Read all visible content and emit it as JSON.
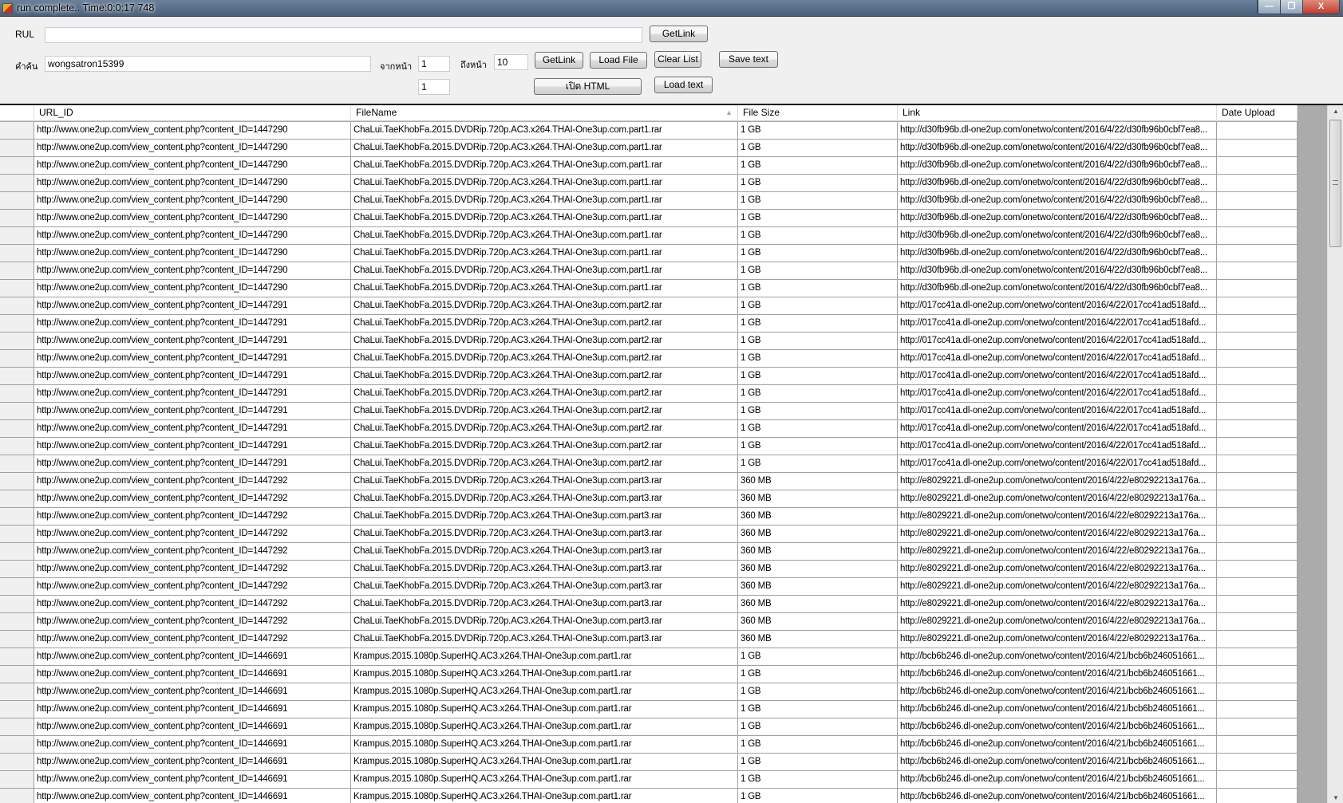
{
  "window": {
    "title": "run complete.. Time:0:0:17 748"
  },
  "form": {
    "url_label": "RUL",
    "url_value": "",
    "getlink_top": "GetLink",
    "search_label": "คำค้น",
    "search_value": "wongsatron15399",
    "from_page_label": "จากหน้า",
    "from_page_value": "1",
    "to_page_label": "ถึงหน้า",
    "to_page_value": "10",
    "getlink2": "GetLink",
    "load_file": "Load File",
    "clear_list": "Clear List",
    "save_text": "Save text",
    "extra_value": "1",
    "open_html": "เปิด HTML",
    "load_text": "Load text"
  },
  "table": {
    "columns": [
      "URL_ID",
      "FileName",
      "File Size",
      "Link",
      "Date Upload"
    ],
    "rows": [
      [
        "http://www.one2up.com/view_content.php?content_ID=1447290",
        "ChaLui.TaeKhobFa.2015.DVDRip.720p.AC3.x264.THAI-One3up.com.part1.rar",
        "1 GB",
        "http://d30fb96b.dl-one2up.com/onetwo/content/2016/4/22/d30fb96b0cbf7ea8...",
        ""
      ],
      [
        "http://www.one2up.com/view_content.php?content_ID=1447290",
        "ChaLui.TaeKhobFa.2015.DVDRip.720p.AC3.x264.THAI-One3up.com.part1.rar",
        "1 GB",
        "http://d30fb96b.dl-one2up.com/onetwo/content/2016/4/22/d30fb96b0cbf7ea8...",
        ""
      ],
      [
        "http://www.one2up.com/view_content.php?content_ID=1447290",
        "ChaLui.TaeKhobFa.2015.DVDRip.720p.AC3.x264.THAI-One3up.com.part1.rar",
        "1 GB",
        "http://d30fb96b.dl-one2up.com/onetwo/content/2016/4/22/d30fb96b0cbf7ea8...",
        ""
      ],
      [
        "http://www.one2up.com/view_content.php?content_ID=1447290",
        "ChaLui.TaeKhobFa.2015.DVDRip.720p.AC3.x264.THAI-One3up.com.part1.rar",
        "1 GB",
        "http://d30fb96b.dl-one2up.com/onetwo/content/2016/4/22/d30fb96b0cbf7ea8...",
        ""
      ],
      [
        "http://www.one2up.com/view_content.php?content_ID=1447290",
        "ChaLui.TaeKhobFa.2015.DVDRip.720p.AC3.x264.THAI-One3up.com.part1.rar",
        "1 GB",
        "http://d30fb96b.dl-one2up.com/onetwo/content/2016/4/22/d30fb96b0cbf7ea8...",
        ""
      ],
      [
        "http://www.one2up.com/view_content.php?content_ID=1447290",
        "ChaLui.TaeKhobFa.2015.DVDRip.720p.AC3.x264.THAI-One3up.com.part1.rar",
        "1 GB",
        "http://d30fb96b.dl-one2up.com/onetwo/content/2016/4/22/d30fb96b0cbf7ea8...",
        ""
      ],
      [
        "http://www.one2up.com/view_content.php?content_ID=1447290",
        "ChaLui.TaeKhobFa.2015.DVDRip.720p.AC3.x264.THAI-One3up.com.part1.rar",
        "1 GB",
        "http://d30fb96b.dl-one2up.com/onetwo/content/2016/4/22/d30fb96b0cbf7ea8...",
        ""
      ],
      [
        "http://www.one2up.com/view_content.php?content_ID=1447290",
        "ChaLui.TaeKhobFa.2015.DVDRip.720p.AC3.x264.THAI-One3up.com.part1.rar",
        "1 GB",
        "http://d30fb96b.dl-one2up.com/onetwo/content/2016/4/22/d30fb96b0cbf7ea8...",
        ""
      ],
      [
        "http://www.one2up.com/view_content.php?content_ID=1447290",
        "ChaLui.TaeKhobFa.2015.DVDRip.720p.AC3.x264.THAI-One3up.com.part1.rar",
        "1 GB",
        "http://d30fb96b.dl-one2up.com/onetwo/content/2016/4/22/d30fb96b0cbf7ea8...",
        ""
      ],
      [
        "http://www.one2up.com/view_content.php?content_ID=1447290",
        "ChaLui.TaeKhobFa.2015.DVDRip.720p.AC3.x264.THAI-One3up.com.part1.rar",
        "1 GB",
        "http://d30fb96b.dl-one2up.com/onetwo/content/2016/4/22/d30fb96b0cbf7ea8...",
        ""
      ],
      [
        "http://www.one2up.com/view_content.php?content_ID=1447291",
        "ChaLui.TaeKhobFa.2015.DVDRip.720p.AC3.x264.THAI-One3up.com.part2.rar",
        "1 GB",
        "http://017cc41a.dl-one2up.com/onetwo/content/2016/4/22/017cc41ad518afd...",
        ""
      ],
      [
        "http://www.one2up.com/view_content.php?content_ID=1447291",
        "ChaLui.TaeKhobFa.2015.DVDRip.720p.AC3.x264.THAI-One3up.com.part2.rar",
        "1 GB",
        "http://017cc41a.dl-one2up.com/onetwo/content/2016/4/22/017cc41ad518afd...",
        ""
      ],
      [
        "http://www.one2up.com/view_content.php?content_ID=1447291",
        "ChaLui.TaeKhobFa.2015.DVDRip.720p.AC3.x264.THAI-One3up.com.part2.rar",
        "1 GB",
        "http://017cc41a.dl-one2up.com/onetwo/content/2016/4/22/017cc41ad518afd...",
        ""
      ],
      [
        "http://www.one2up.com/view_content.php?content_ID=1447291",
        "ChaLui.TaeKhobFa.2015.DVDRip.720p.AC3.x264.THAI-One3up.com.part2.rar",
        "1 GB",
        "http://017cc41a.dl-one2up.com/onetwo/content/2016/4/22/017cc41ad518afd...",
        ""
      ],
      [
        "http://www.one2up.com/view_content.php?content_ID=1447291",
        "ChaLui.TaeKhobFa.2015.DVDRip.720p.AC3.x264.THAI-One3up.com.part2.rar",
        "1 GB",
        "http://017cc41a.dl-one2up.com/onetwo/content/2016/4/22/017cc41ad518afd...",
        ""
      ],
      [
        "http://www.one2up.com/view_content.php?content_ID=1447291",
        "ChaLui.TaeKhobFa.2015.DVDRip.720p.AC3.x264.THAI-One3up.com.part2.rar",
        "1 GB",
        "http://017cc41a.dl-one2up.com/onetwo/content/2016/4/22/017cc41ad518afd...",
        ""
      ],
      [
        "http://www.one2up.com/view_content.php?content_ID=1447291",
        "ChaLui.TaeKhobFa.2015.DVDRip.720p.AC3.x264.THAI-One3up.com.part2.rar",
        "1 GB",
        "http://017cc41a.dl-one2up.com/onetwo/content/2016/4/22/017cc41ad518afd...",
        ""
      ],
      [
        "http://www.one2up.com/view_content.php?content_ID=1447291",
        "ChaLui.TaeKhobFa.2015.DVDRip.720p.AC3.x264.THAI-One3up.com.part2.rar",
        "1 GB",
        "http://017cc41a.dl-one2up.com/onetwo/content/2016/4/22/017cc41ad518afd...",
        ""
      ],
      [
        "http://www.one2up.com/view_content.php?content_ID=1447291",
        "ChaLui.TaeKhobFa.2015.DVDRip.720p.AC3.x264.THAI-One3up.com.part2.rar",
        "1 GB",
        "http://017cc41a.dl-one2up.com/onetwo/content/2016/4/22/017cc41ad518afd...",
        ""
      ],
      [
        "http://www.one2up.com/view_content.php?content_ID=1447291",
        "ChaLui.TaeKhobFa.2015.DVDRip.720p.AC3.x264.THAI-One3up.com.part2.rar",
        "1 GB",
        "http://017cc41a.dl-one2up.com/onetwo/content/2016/4/22/017cc41ad518afd...",
        ""
      ],
      [
        "http://www.one2up.com/view_content.php?content_ID=1447292",
        "ChaLui.TaeKhobFa.2015.DVDRip.720p.AC3.x264.THAI-One3up.com.part3.rar",
        "360 MB",
        "http://e8029221.dl-one2up.com/onetwo/content/2016/4/22/e80292213a176a...",
        ""
      ],
      [
        "http://www.one2up.com/view_content.php?content_ID=1447292",
        "ChaLui.TaeKhobFa.2015.DVDRip.720p.AC3.x264.THAI-One3up.com.part3.rar",
        "360 MB",
        "http://e8029221.dl-one2up.com/onetwo/content/2016/4/22/e80292213a176a...",
        ""
      ],
      [
        "http://www.one2up.com/view_content.php?content_ID=1447292",
        "ChaLui.TaeKhobFa.2015.DVDRip.720p.AC3.x264.THAI-One3up.com.part3.rar",
        "360 MB",
        "http://e8029221.dl-one2up.com/onetwo/content/2016/4/22/e80292213a176a...",
        ""
      ],
      [
        "http://www.one2up.com/view_content.php?content_ID=1447292",
        "ChaLui.TaeKhobFa.2015.DVDRip.720p.AC3.x264.THAI-One3up.com.part3.rar",
        "360 MB",
        "http://e8029221.dl-one2up.com/onetwo/content/2016/4/22/e80292213a176a...",
        ""
      ],
      [
        "http://www.one2up.com/view_content.php?content_ID=1447292",
        "ChaLui.TaeKhobFa.2015.DVDRip.720p.AC3.x264.THAI-One3up.com.part3.rar",
        "360 MB",
        "http://e8029221.dl-one2up.com/onetwo/content/2016/4/22/e80292213a176a...",
        ""
      ],
      [
        "http://www.one2up.com/view_content.php?content_ID=1447292",
        "ChaLui.TaeKhobFa.2015.DVDRip.720p.AC3.x264.THAI-One3up.com.part3.rar",
        "360 MB",
        "http://e8029221.dl-one2up.com/onetwo/content/2016/4/22/e80292213a176a...",
        ""
      ],
      [
        "http://www.one2up.com/view_content.php?content_ID=1447292",
        "ChaLui.TaeKhobFa.2015.DVDRip.720p.AC3.x264.THAI-One3up.com.part3.rar",
        "360 MB",
        "http://e8029221.dl-one2up.com/onetwo/content/2016/4/22/e80292213a176a...",
        ""
      ],
      [
        "http://www.one2up.com/view_content.php?content_ID=1447292",
        "ChaLui.TaeKhobFa.2015.DVDRip.720p.AC3.x264.THAI-One3up.com.part3.rar",
        "360 MB",
        "http://e8029221.dl-one2up.com/onetwo/content/2016/4/22/e80292213a176a...",
        ""
      ],
      [
        "http://www.one2up.com/view_content.php?content_ID=1447292",
        "ChaLui.TaeKhobFa.2015.DVDRip.720p.AC3.x264.THAI-One3up.com.part3.rar",
        "360 MB",
        "http://e8029221.dl-one2up.com/onetwo/content/2016/4/22/e80292213a176a...",
        ""
      ],
      [
        "http://www.one2up.com/view_content.php?content_ID=1447292",
        "ChaLui.TaeKhobFa.2015.DVDRip.720p.AC3.x264.THAI-One3up.com.part3.rar",
        "360 MB",
        "http://e8029221.dl-one2up.com/onetwo/content/2016/4/22/e80292213a176a...",
        ""
      ],
      [
        "http://www.one2up.com/view_content.php?content_ID=1446691",
        "Krampus.2015.1080p.SuperHQ.AC3.x264.THAI-One3up.com.part1.rar",
        "1 GB",
        "http://bcb6b246.dl-one2up.com/onetwo/content/2016/4/21/bcb6b246051661...",
        ""
      ],
      [
        "http://www.one2up.com/view_content.php?content_ID=1446691",
        "Krampus.2015.1080p.SuperHQ.AC3.x264.THAI-One3up.com.part1.rar",
        "1 GB",
        "http://bcb6b246.dl-one2up.com/onetwo/content/2016/4/21/bcb6b246051661...",
        ""
      ],
      [
        "http://www.one2up.com/view_content.php?content_ID=1446691",
        "Krampus.2015.1080p.SuperHQ.AC3.x264.THAI-One3up.com.part1.rar",
        "1 GB",
        "http://bcb6b246.dl-one2up.com/onetwo/content/2016/4/21/bcb6b246051661...",
        ""
      ],
      [
        "http://www.one2up.com/view_content.php?content_ID=1446691",
        "Krampus.2015.1080p.SuperHQ.AC3.x264.THAI-One3up.com.part1.rar",
        "1 GB",
        "http://bcb6b246.dl-one2up.com/onetwo/content/2016/4/21/bcb6b246051661...",
        ""
      ],
      [
        "http://www.one2up.com/view_content.php?content_ID=1446691",
        "Krampus.2015.1080p.SuperHQ.AC3.x264.THAI-One3up.com.part1.rar",
        "1 GB",
        "http://bcb6b246.dl-one2up.com/onetwo/content/2016/4/21/bcb6b246051661...",
        ""
      ],
      [
        "http://www.one2up.com/view_content.php?content_ID=1446691",
        "Krampus.2015.1080p.SuperHQ.AC3.x264.THAI-One3up.com.part1.rar",
        "1 GB",
        "http://bcb6b246.dl-one2up.com/onetwo/content/2016/4/21/bcb6b246051661...",
        ""
      ],
      [
        "http://www.one2up.com/view_content.php?content_ID=1446691",
        "Krampus.2015.1080p.SuperHQ.AC3.x264.THAI-One3up.com.part1.rar",
        "1 GB",
        "http://bcb6b246.dl-one2up.com/onetwo/content/2016/4/21/bcb6b246051661...",
        ""
      ],
      [
        "http://www.one2up.com/view_content.php?content_ID=1446691",
        "Krampus.2015.1080p.SuperHQ.AC3.x264.THAI-One3up.com.part1.rar",
        "1 GB",
        "http://bcb6b246.dl-one2up.com/onetwo/content/2016/4/21/bcb6b246051661...",
        ""
      ],
      [
        "http://www.one2up.com/view_content.php?content_ID=1446691",
        "Krampus.2015.1080p.SuperHQ.AC3.x264.THAI-One3up.com.part1.rar",
        "1 GB",
        "http://bcb6b246.dl-one2up.com/onetwo/content/2016/4/21/bcb6b246051661...",
        ""
      ]
    ]
  }
}
